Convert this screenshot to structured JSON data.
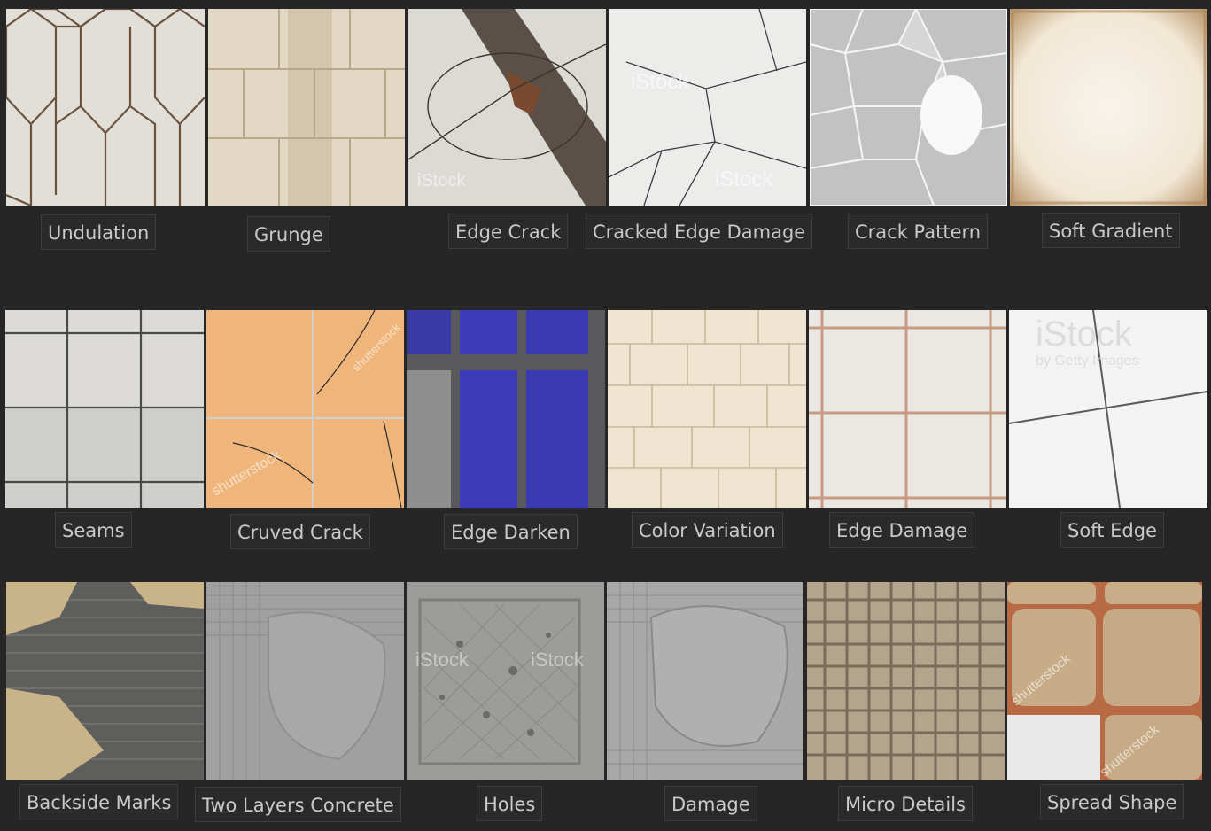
{
  "tiles": [
    {
      "label": "Undulation"
    },
    {
      "label": "Grunge"
    },
    {
      "label": "Edge Crack"
    },
    {
      "label": "Cracked Edge Damage"
    },
    {
      "label": "Crack Pattern"
    },
    {
      "label": "Soft Gradient"
    },
    {
      "label": "Seams"
    },
    {
      "label": "Cruved Crack"
    },
    {
      "label": "Edge Darken"
    },
    {
      "label": "Color Variation"
    },
    {
      "label": "Edge Damage"
    },
    {
      "label": "Soft Edge"
    },
    {
      "label": "Backside Marks"
    },
    {
      "label": "Two Layers Concrete"
    },
    {
      "label": "Holes"
    },
    {
      "label": "Damage"
    },
    {
      "label": "Micro Details"
    },
    {
      "label": "Spread Shape"
    }
  ],
  "watermarks": {
    "istock": "iStock",
    "getty": "by Getty Images",
    "shutterstock": "shutterstock"
  },
  "colors": {
    "background": "#262626",
    "label_bg": "#2a2a2a",
    "label_text": "#c9c9c9"
  }
}
